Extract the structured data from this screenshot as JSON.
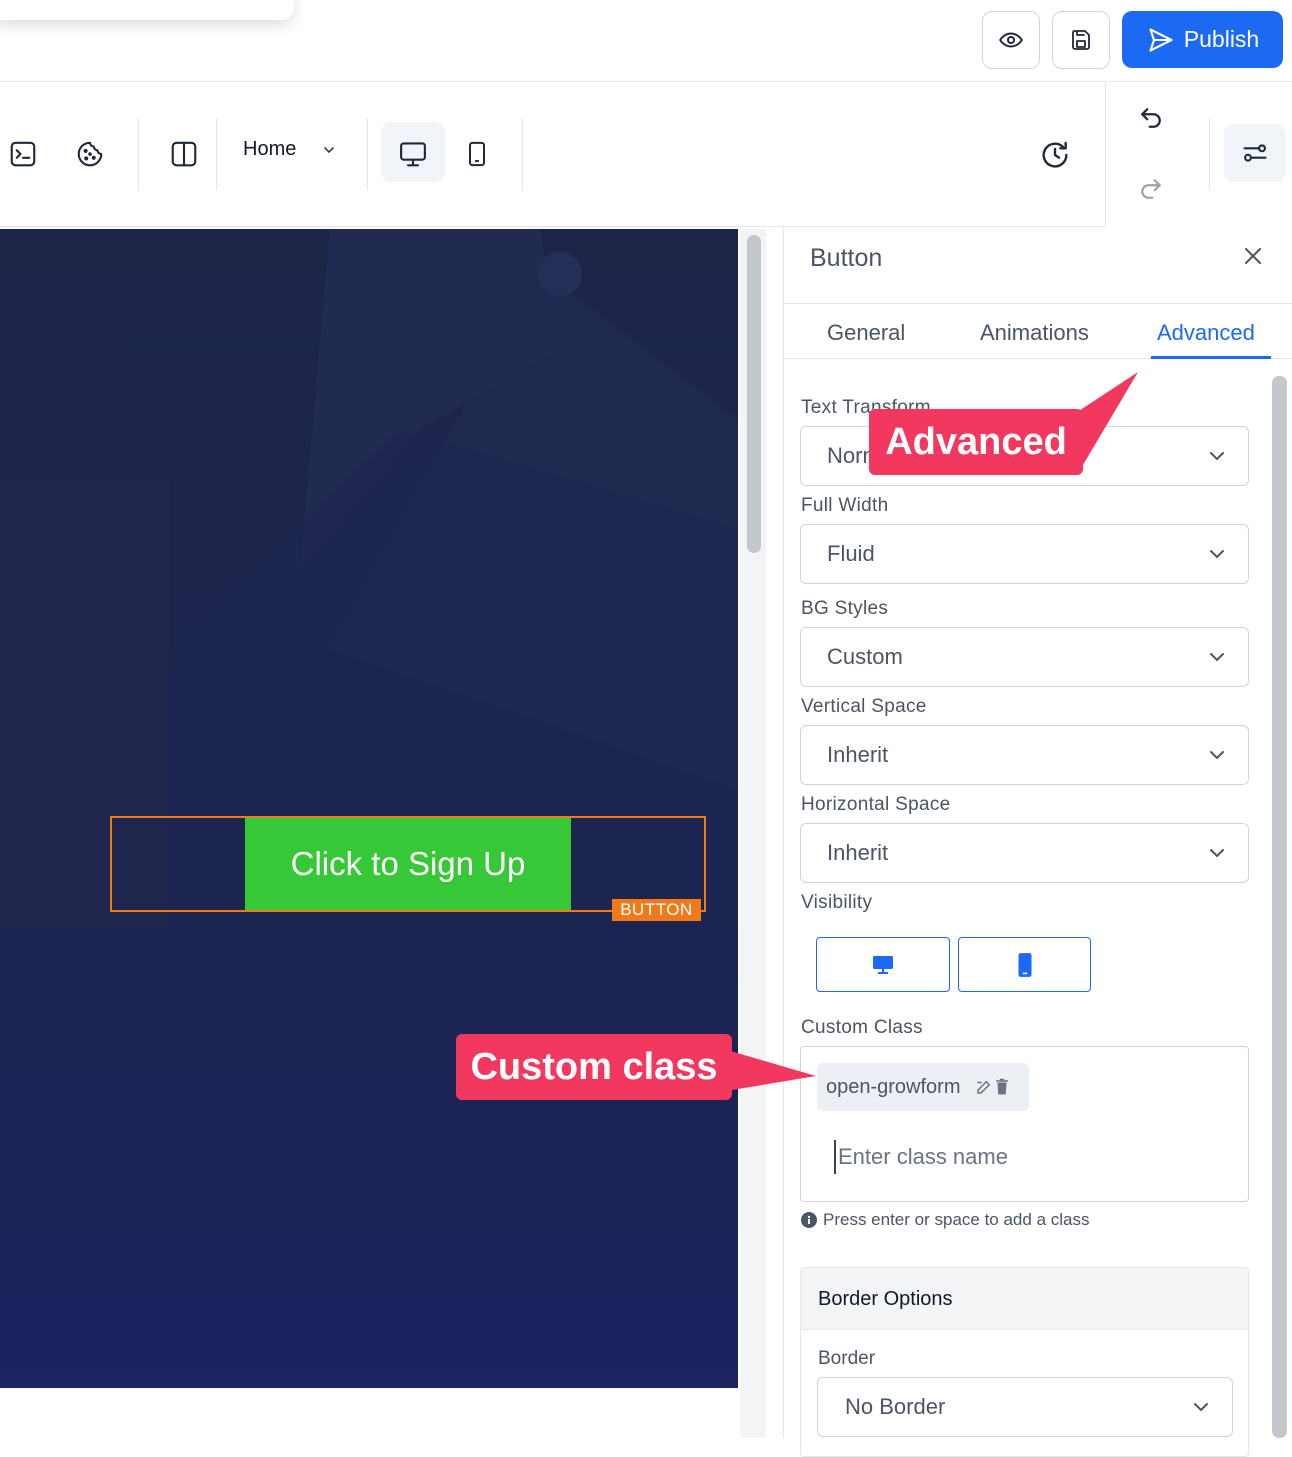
{
  "header": {
    "publish_label": "Publish",
    "icons": [
      "eye-icon",
      "save-icon",
      "send-icon"
    ]
  },
  "toolbar": {
    "page_select": "Home",
    "icons": [
      "terminal-icon",
      "cookie-icon",
      "layout-columns-icon",
      "chevron-down-icon",
      "desktop-icon",
      "mobile-icon",
      "history-icon",
      "undo-icon",
      "redo-icon",
      "settings-sliders-icon"
    ]
  },
  "canvas": {
    "button_text": "Click to Sign Up",
    "element_tag": "BUTTON",
    "colors": {
      "button_bg": "#37c837",
      "selection": "#f07a1a",
      "background": "#1c2548"
    }
  },
  "panel": {
    "title": "Button",
    "tabs": [
      {
        "label": "General"
      },
      {
        "label": "Animations"
      },
      {
        "label": "Advanced",
        "active": true
      }
    ],
    "fields": [
      {
        "label": "Text Transform",
        "value": "Normal"
      },
      {
        "label": "Full Width",
        "value": "Fluid"
      },
      {
        "label": "BG Styles",
        "value": "Custom"
      },
      {
        "label": "Vertical Space",
        "value": "Inherit"
      },
      {
        "label": "Horizontal Space",
        "value": "Inherit"
      }
    ],
    "visibility_label": "Visibility",
    "custom_class_label": "Custom Class",
    "custom_class_chip": "open-growform",
    "class_input_placeholder": "Enter class name",
    "hint": "Press enter or space to add a class",
    "border_options": {
      "title": "Border Options",
      "border_label": "Border",
      "border_value": "No Border"
    }
  },
  "annotations": {
    "advanced": "Advanced",
    "custom_class": "Custom class",
    "color": "#f2385e"
  },
  "colors": {
    "accent": "#1d6af2"
  }
}
